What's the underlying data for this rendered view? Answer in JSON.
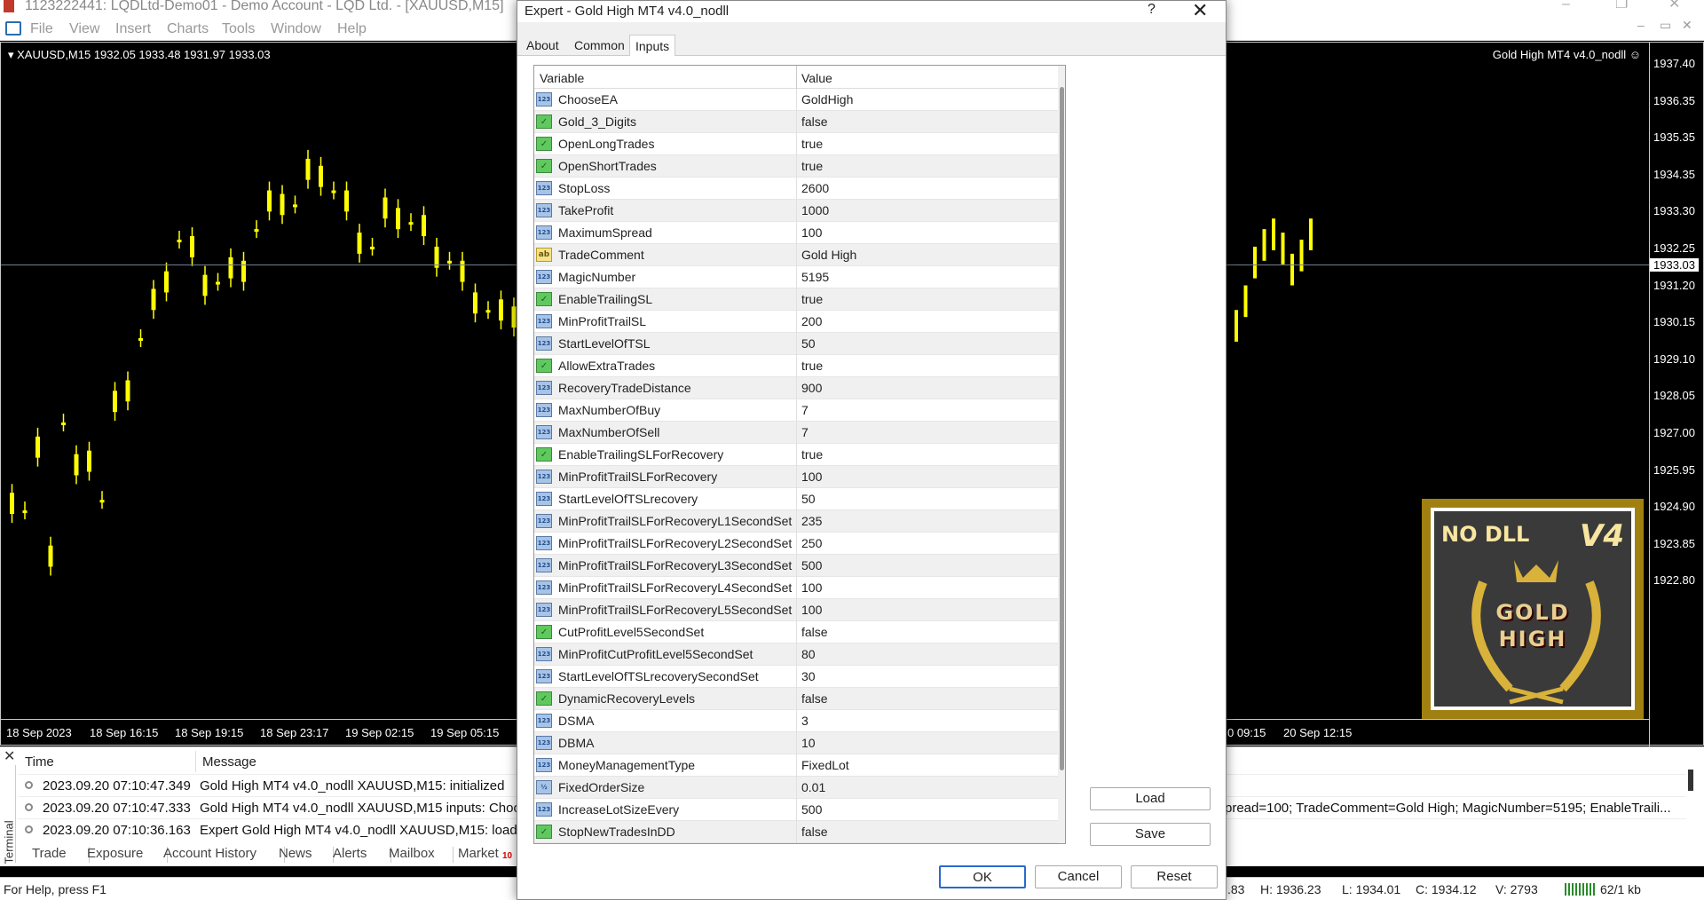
{
  "window_title": "1123222441: LQDLtd-Demo01 - Demo Account - LQD Ltd. - [XAUUSD,M15]",
  "menu": [
    "File",
    "View",
    "Insert",
    "Charts",
    "Tools",
    "Window",
    "Help"
  ],
  "chart": {
    "header": "XAUUSD,M15  1932.05 1933.48 1931.97 1933.03",
    "ea_label": "Gold High MT4 v4.0_nodll",
    "current_price": "1933.03",
    "price_labels": [
      "1937.40",
      "1936.35",
      "1935.35",
      "1934.35",
      "1933.30",
      "1932.25",
      "1931.20",
      "1930.15",
      "1929.10",
      "1928.05",
      "1927.00",
      "1925.95",
      "1924.90",
      "1923.85",
      "1922.80"
    ],
    "time_labels": [
      "18 Sep 2023",
      "18 Sep 16:15",
      "18 Sep 19:15",
      "18 Sep 23:17",
      "19 Sep 02:15",
      "19 Sep 05:15",
      "0 09:15",
      "20 Sep 12:15"
    ],
    "colors": {
      "candle": "#ffff00",
      "background": "#000000",
      "grid": "#708090"
    }
  },
  "logo": {
    "top_left": "NO DLL",
    "top_right": "V4",
    "line1": "GOLD",
    "line2": "HIGH"
  },
  "terminal": {
    "side_label": "Terminal",
    "columns": [
      "Time",
      "Message"
    ],
    "rows": [
      {
        "time": "2023.09.20 07:10:47.349",
        "message": "Gold High MT4 v4.0_nodll XAUUSD,M15: initialized"
      },
      {
        "time": "2023.09.20 07:10:47.333",
        "message": "Gold High MT4 v4.0_nodll XAUUSD,M15 inputs: Choos",
        "message_tail": "pread=100; TradeComment=Gold High; MagicNumber=5195; EnableTraili..."
      },
      {
        "time": "2023.09.20 07:10:36.163",
        "message": "Expert Gold High MT4 v4.0_nodll XAUUSD,M15: loade"
      }
    ],
    "tabs": [
      "Trade",
      "Exposure",
      "Account History",
      "News",
      "Alerts",
      "Mailbox",
      "Market"
    ],
    "market_badge": "10"
  },
  "statusbar": {
    "help": "For Help, press F1",
    "partial": ".83",
    "high": "H: 1936.23",
    "low": "L: 1934.01",
    "close": "C: 1934.12",
    "volume": "V: 2793",
    "traffic": "62/1 kb"
  },
  "dialog": {
    "title": "Expert - Gold High MT4 v4.0_nodll",
    "help_label": "?",
    "tabs": [
      "About",
      "Common",
      "Inputs"
    ],
    "active_tab": "Inputs",
    "columns": {
      "variable": "Variable",
      "value": "Value"
    },
    "params": [
      {
        "name": "ChooseEA",
        "value": "GoldHigh",
        "type": "int"
      },
      {
        "name": "Gold_3_Digits",
        "value": "false",
        "type": "bool"
      },
      {
        "name": "OpenLongTrades",
        "value": "true",
        "type": "bool"
      },
      {
        "name": "OpenShortTrades",
        "value": "true",
        "type": "bool"
      },
      {
        "name": "StopLoss",
        "value": "2600",
        "type": "int"
      },
      {
        "name": "TakeProfit",
        "value": "1000",
        "type": "int"
      },
      {
        "name": "MaximumSpread",
        "value": "100",
        "type": "int"
      },
      {
        "name": "TradeComment",
        "value": "Gold High",
        "type": "str"
      },
      {
        "name": "MagicNumber",
        "value": "5195",
        "type": "int"
      },
      {
        "name": "EnableTrailingSL",
        "value": "true",
        "type": "bool"
      },
      {
        "name": "MinProfitTrailSL",
        "value": "200",
        "type": "int"
      },
      {
        "name": "StartLevelOfTSL",
        "value": "50",
        "type": "int"
      },
      {
        "name": "AllowExtraTrades",
        "value": "true",
        "type": "bool"
      },
      {
        "name": "RecoveryTradeDistance",
        "value": "900",
        "type": "int"
      },
      {
        "name": "MaxNumberOfBuy",
        "value": "7",
        "type": "int"
      },
      {
        "name": "MaxNumberOfSell",
        "value": "7",
        "type": "int"
      },
      {
        "name": "EnableTrailingSLForRecovery",
        "value": "true",
        "type": "bool"
      },
      {
        "name": "MinProfitTrailSLForRecovery",
        "value": "100",
        "type": "int"
      },
      {
        "name": "StartLevelOfTSLrecovery",
        "value": "50",
        "type": "int"
      },
      {
        "name": "MinProfitTrailSLForRecoveryL1SecondSet",
        "value": "235",
        "type": "int"
      },
      {
        "name": "MinProfitTrailSLForRecoveryL2SecondSet",
        "value": "250",
        "type": "int"
      },
      {
        "name": "MinProfitTrailSLForRecoveryL3SecondSet",
        "value": "500",
        "type": "int"
      },
      {
        "name": "MinProfitTrailSLForRecoveryL4SecondSet",
        "value": "100",
        "type": "int"
      },
      {
        "name": "MinProfitTrailSLForRecoveryL5SecondSet",
        "value": "100",
        "type": "int"
      },
      {
        "name": "CutProfitLevel5SecondSet",
        "value": "false",
        "type": "bool"
      },
      {
        "name": "MinProfitCutProfitLevel5SecondSet",
        "value": "80",
        "type": "int"
      },
      {
        "name": "StartLevelOfTSLrecoverySecondSet",
        "value": "30",
        "type": "int"
      },
      {
        "name": "DynamicRecoveryLevels",
        "value": "false",
        "type": "bool"
      },
      {
        "name": "DSMA",
        "value": "3",
        "type": "int"
      },
      {
        "name": "DBMA",
        "value": "10",
        "type": "int"
      },
      {
        "name": "MoneyManagementType",
        "value": "FixedLot",
        "type": "int"
      },
      {
        "name": "FixedOrderSize",
        "value": "0.01",
        "type": "dbl"
      },
      {
        "name": "IncreaseLotSizeEvery",
        "value": "500",
        "type": "int"
      },
      {
        "name": "StopNewTradesInDD",
        "value": "false",
        "type": "bool"
      }
    ],
    "buttons": {
      "load": "Load",
      "save": "Save",
      "ok": "OK",
      "cancel": "Cancel",
      "reset": "Reset"
    }
  }
}
